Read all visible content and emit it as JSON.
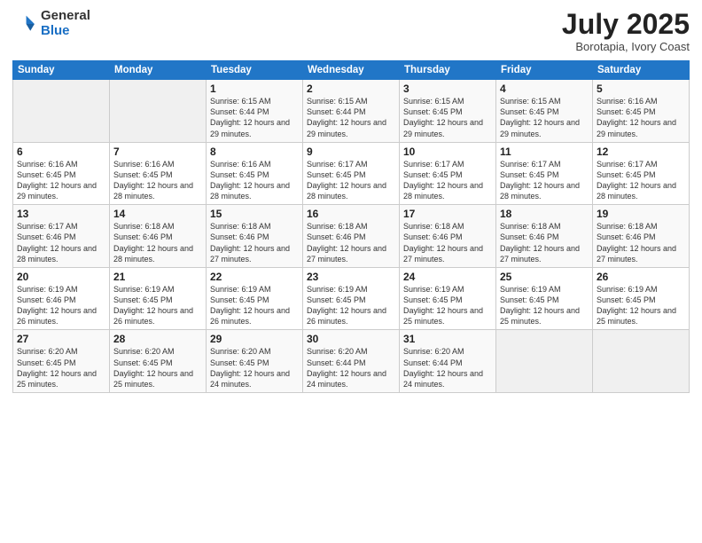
{
  "header": {
    "logo_general": "General",
    "logo_blue": "Blue",
    "month": "July 2025",
    "location": "Borotapia, Ivory Coast"
  },
  "weekdays": [
    "Sunday",
    "Monday",
    "Tuesday",
    "Wednesday",
    "Thursday",
    "Friday",
    "Saturday"
  ],
  "weeks": [
    [
      {
        "day": "",
        "info": ""
      },
      {
        "day": "",
        "info": ""
      },
      {
        "day": "1",
        "info": "Sunrise: 6:15 AM\nSunset: 6:44 PM\nDaylight: 12 hours and 29 minutes."
      },
      {
        "day": "2",
        "info": "Sunrise: 6:15 AM\nSunset: 6:44 PM\nDaylight: 12 hours and 29 minutes."
      },
      {
        "day": "3",
        "info": "Sunrise: 6:15 AM\nSunset: 6:45 PM\nDaylight: 12 hours and 29 minutes."
      },
      {
        "day": "4",
        "info": "Sunrise: 6:15 AM\nSunset: 6:45 PM\nDaylight: 12 hours and 29 minutes."
      },
      {
        "day": "5",
        "info": "Sunrise: 6:16 AM\nSunset: 6:45 PM\nDaylight: 12 hours and 29 minutes."
      }
    ],
    [
      {
        "day": "6",
        "info": "Sunrise: 6:16 AM\nSunset: 6:45 PM\nDaylight: 12 hours and 29 minutes."
      },
      {
        "day": "7",
        "info": "Sunrise: 6:16 AM\nSunset: 6:45 PM\nDaylight: 12 hours and 28 minutes."
      },
      {
        "day": "8",
        "info": "Sunrise: 6:16 AM\nSunset: 6:45 PM\nDaylight: 12 hours and 28 minutes."
      },
      {
        "day": "9",
        "info": "Sunrise: 6:17 AM\nSunset: 6:45 PM\nDaylight: 12 hours and 28 minutes."
      },
      {
        "day": "10",
        "info": "Sunrise: 6:17 AM\nSunset: 6:45 PM\nDaylight: 12 hours and 28 minutes."
      },
      {
        "day": "11",
        "info": "Sunrise: 6:17 AM\nSunset: 6:45 PM\nDaylight: 12 hours and 28 minutes."
      },
      {
        "day": "12",
        "info": "Sunrise: 6:17 AM\nSunset: 6:45 PM\nDaylight: 12 hours and 28 minutes."
      }
    ],
    [
      {
        "day": "13",
        "info": "Sunrise: 6:17 AM\nSunset: 6:46 PM\nDaylight: 12 hours and 28 minutes."
      },
      {
        "day": "14",
        "info": "Sunrise: 6:18 AM\nSunset: 6:46 PM\nDaylight: 12 hours and 28 minutes."
      },
      {
        "day": "15",
        "info": "Sunrise: 6:18 AM\nSunset: 6:46 PM\nDaylight: 12 hours and 27 minutes."
      },
      {
        "day": "16",
        "info": "Sunrise: 6:18 AM\nSunset: 6:46 PM\nDaylight: 12 hours and 27 minutes."
      },
      {
        "day": "17",
        "info": "Sunrise: 6:18 AM\nSunset: 6:46 PM\nDaylight: 12 hours and 27 minutes."
      },
      {
        "day": "18",
        "info": "Sunrise: 6:18 AM\nSunset: 6:46 PM\nDaylight: 12 hours and 27 minutes."
      },
      {
        "day": "19",
        "info": "Sunrise: 6:18 AM\nSunset: 6:46 PM\nDaylight: 12 hours and 27 minutes."
      }
    ],
    [
      {
        "day": "20",
        "info": "Sunrise: 6:19 AM\nSunset: 6:46 PM\nDaylight: 12 hours and 26 minutes."
      },
      {
        "day": "21",
        "info": "Sunrise: 6:19 AM\nSunset: 6:45 PM\nDaylight: 12 hours and 26 minutes."
      },
      {
        "day": "22",
        "info": "Sunrise: 6:19 AM\nSunset: 6:45 PM\nDaylight: 12 hours and 26 minutes."
      },
      {
        "day": "23",
        "info": "Sunrise: 6:19 AM\nSunset: 6:45 PM\nDaylight: 12 hours and 26 minutes."
      },
      {
        "day": "24",
        "info": "Sunrise: 6:19 AM\nSunset: 6:45 PM\nDaylight: 12 hours and 25 minutes."
      },
      {
        "day": "25",
        "info": "Sunrise: 6:19 AM\nSunset: 6:45 PM\nDaylight: 12 hours and 25 minutes."
      },
      {
        "day": "26",
        "info": "Sunrise: 6:19 AM\nSunset: 6:45 PM\nDaylight: 12 hours and 25 minutes."
      }
    ],
    [
      {
        "day": "27",
        "info": "Sunrise: 6:20 AM\nSunset: 6:45 PM\nDaylight: 12 hours and 25 minutes."
      },
      {
        "day": "28",
        "info": "Sunrise: 6:20 AM\nSunset: 6:45 PM\nDaylight: 12 hours and 25 minutes."
      },
      {
        "day": "29",
        "info": "Sunrise: 6:20 AM\nSunset: 6:45 PM\nDaylight: 12 hours and 24 minutes."
      },
      {
        "day": "30",
        "info": "Sunrise: 6:20 AM\nSunset: 6:44 PM\nDaylight: 12 hours and 24 minutes."
      },
      {
        "day": "31",
        "info": "Sunrise: 6:20 AM\nSunset: 6:44 PM\nDaylight: 12 hours and 24 minutes."
      },
      {
        "day": "",
        "info": ""
      },
      {
        "day": "",
        "info": ""
      }
    ]
  ],
  "colors": {
    "header_bg": "#2176c7",
    "accent": "#1a6fc4"
  }
}
